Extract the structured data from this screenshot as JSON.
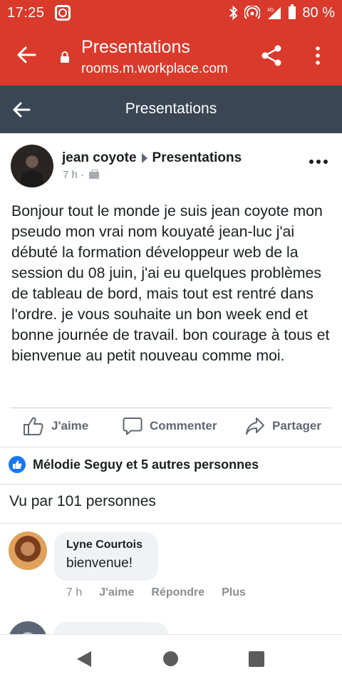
{
  "status_bar": {
    "time": "17:25",
    "battery": "80 %"
  },
  "browser": {
    "title": "Presentations",
    "url": "rooms.m.workplace.com"
  },
  "page_header": {
    "title": "Presentations"
  },
  "post": {
    "author": "jean coyote",
    "group": "Presentations",
    "time": "7 h ·",
    "text": "Bonjour tout le monde je suis jean coyote mon pseudo mon vrai nom kouyaté jean-luc j'ai débuté la formation développeur web de la session du 08 juin, j'ai eu quelques problèmes de tableau de bord, mais tout est rentré dans l'ordre. je vous souhaite un bon week end et bonne journée de travail. bon courage à tous et bienvenue au petit nouveau comme moi."
  },
  "actions": {
    "like": "J'aime",
    "comment": "Commenter",
    "share": "Partager"
  },
  "reactions": {
    "summary": "Mélodie Seguy et 5 autres personnes"
  },
  "seen_by": "Vu par 101 personnes",
  "comments": [
    {
      "author": "Lyne Courtois",
      "text": "bienvenue!",
      "time": "7 h",
      "like": "J'aime",
      "reply": "Répondre",
      "more": "Plus"
    }
  ],
  "colors": {
    "brand_red": "#d93a2b",
    "header_slate": "#3b4654",
    "like_blue": "#1877f2"
  }
}
